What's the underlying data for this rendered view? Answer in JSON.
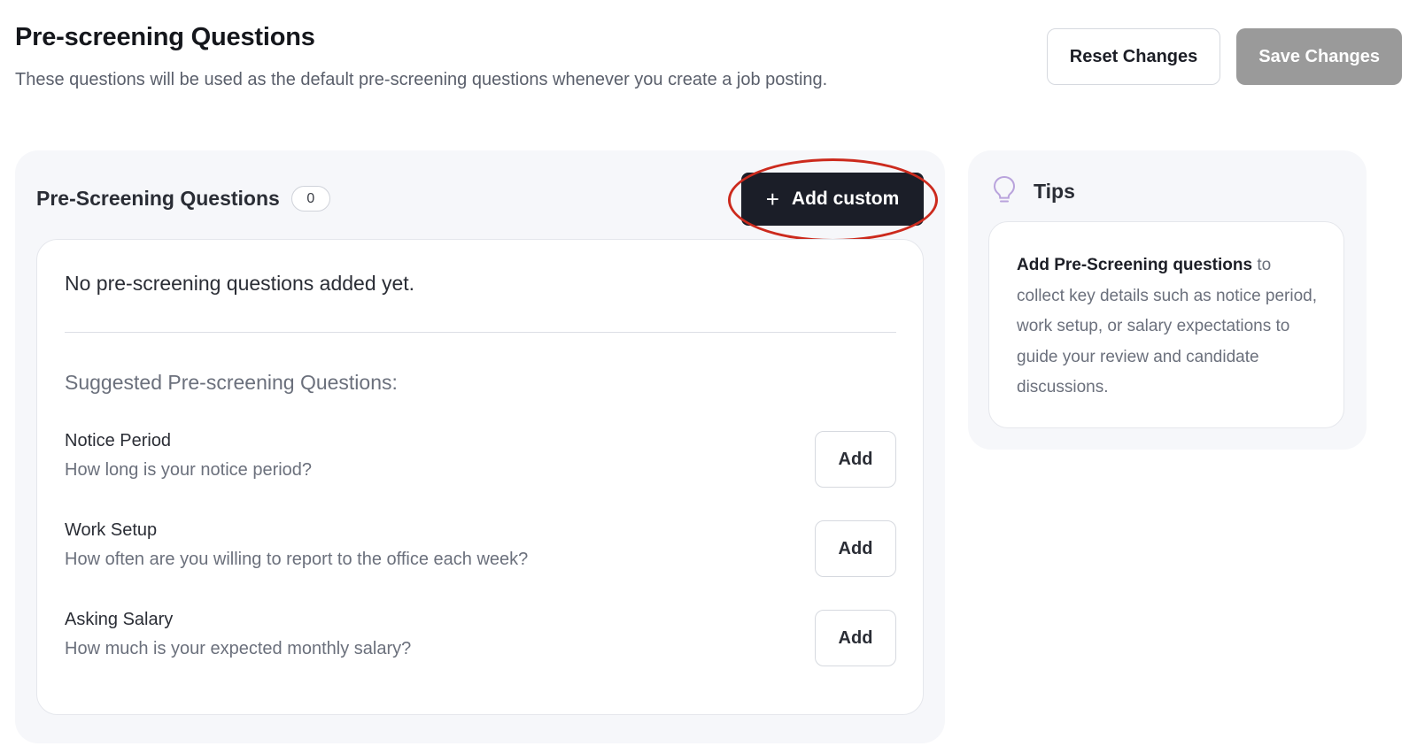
{
  "header": {
    "title": "Pre-screening Questions",
    "subtitle": "These questions will be used as the default pre-screening questions whenever you create a job posting.",
    "reset_label": "Reset Changes",
    "save_label": "Save Changes"
  },
  "panel": {
    "title": "Pre-Screening Questions",
    "count": "0",
    "add_custom_icon": "+",
    "add_custom_label": "Add custom",
    "empty_text": "No pre-screening questions added yet.",
    "suggested_heading": "Suggested Pre-screening Questions:",
    "suggestions": [
      {
        "label": "Notice Period",
        "question": "How long is your notice period?",
        "button": "Add"
      },
      {
        "label": "Work Setup",
        "question": "How often are you willing to report to the office each week?",
        "button": "Add"
      },
      {
        "label": "Asking Salary",
        "question": "How much is your expected monthly salary?",
        "button": "Add"
      }
    ]
  },
  "tips": {
    "title": "Tips",
    "icon": "lightbulb-icon",
    "bold_text": "Add Pre-Screening questions",
    "body_text": " to collect key details such as notice period, work setup, or salary expectations to guide your review and candidate discussions."
  },
  "colors": {
    "primary_button": "#1b1e28",
    "disabled_button": "#9a9a9a",
    "panel_background": "#f6f7fa",
    "highlight_ring": "#cc2a1d",
    "tips_icon": "#b9a3dc"
  }
}
